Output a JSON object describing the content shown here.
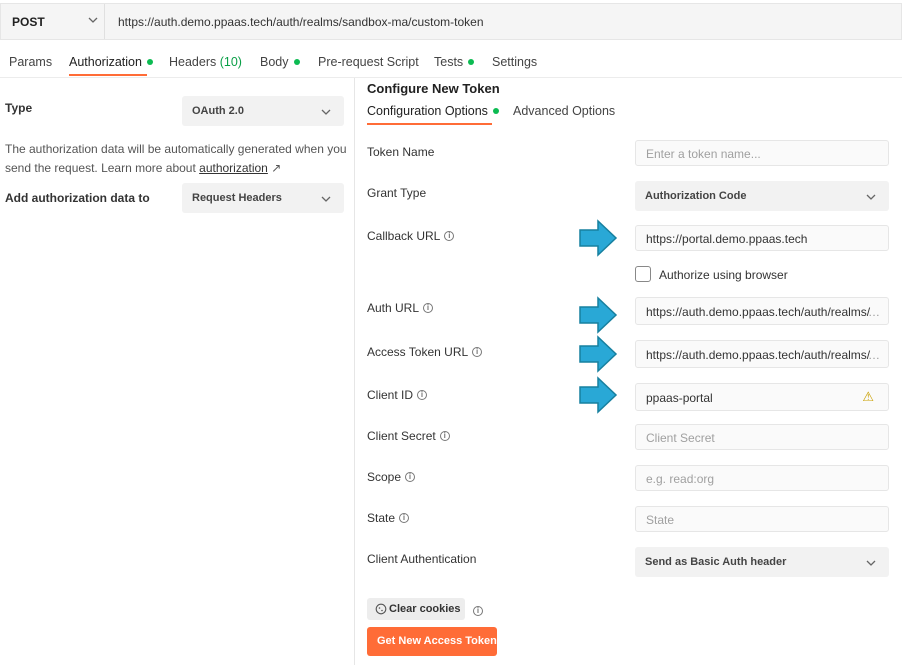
{
  "request": {
    "method": "POST",
    "url": "https://auth.demo.ppaas.tech/auth/realms/sandbox-ma/custom-token"
  },
  "tabs": {
    "params": "Params",
    "authorization": "Authorization",
    "headers": "Headers",
    "headers_count": "(10)",
    "body": "Body",
    "prerequest": "Pre-request Script",
    "tests": "Tests",
    "settings": "Settings"
  },
  "left": {
    "type_label": "Type",
    "type_value": "OAuth 2.0",
    "help_text": "The authorization data will be automatically generated when you send the request. Learn more about",
    "help_link": "authorization",
    "help_link_arrow": "↗",
    "add_to_label": "Add authorization data to",
    "add_to_value": "Request Headers"
  },
  "config": {
    "title": "Configure New Token",
    "subtab_options": "Configuration Options",
    "subtab_advanced": "Advanced Options",
    "token_name_label": "Token Name",
    "token_name_placeholder": "Enter a token name...",
    "grant_type_label": "Grant Type",
    "grant_type_value": "Authorization Code",
    "callback_url_label": "Callback URL",
    "callback_url_value": "https://portal.demo.ppaas.tech",
    "authorize_browser_label": "Authorize using browser",
    "auth_url_label": "Auth URL",
    "auth_url_value": "https://auth.demo.ppaas.tech/auth/realms/",
    "access_token_url_label": "Access Token URL",
    "access_token_url_value": "https://auth.demo.ppaas.tech/auth/realms/",
    "ellipsis": "…",
    "client_id_label": "Client ID",
    "client_id_value": "ppaas-portal",
    "client_secret_label": "Client Secret",
    "client_secret_placeholder": "Client Secret",
    "scope_label": "Scope",
    "scope_placeholder": "e.g. read:org",
    "state_label": "State",
    "state_placeholder": "State",
    "client_auth_label": "Client Authentication",
    "client_auth_value": "Send as Basic Auth header",
    "clear_cookies": "Clear cookies",
    "get_token": "Get New Access Token",
    "info_glyph": "i",
    "warning_glyph": "⚠"
  },
  "colors": {
    "accent": "#ff6c37",
    "status_dot": "#0cbb52",
    "arrow": "#29a8d6",
    "warning": "#c9a000"
  },
  "icons": {
    "dropdown": "chevron-down-icon",
    "info": "info-icon",
    "warning": "warning-icon",
    "cookie": "cookie-icon",
    "pointer": "arrow-right-icon"
  }
}
